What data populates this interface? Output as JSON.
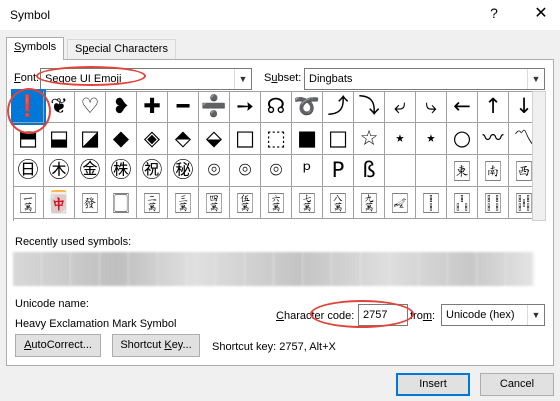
{
  "window": {
    "title": "Symbol",
    "help_glyph": "?",
    "close_glyph": "✕"
  },
  "tabs": [
    {
      "label": "Symbols",
      "active": true
    },
    {
      "label": "Special Characters",
      "active": false
    }
  ],
  "font": {
    "label": "Font:",
    "value": "Segoe UI Emoji"
  },
  "subset": {
    "label": "Subset:",
    "value": "Dingbats"
  },
  "grid": {
    "rows": [
      [
        "❗",
        "❦",
        "♡",
        "❥",
        "✚",
        "━",
        "➗",
        "➙",
        "☊",
        "➰",
        "⤴",
        "⤵",
        "⤶",
        "⤷",
        "←",
        "↑",
        "↓"
      ],
      [
        "⬒",
        "⬓",
        "◪",
        "◆",
        "◈",
        "⬘",
        "⬙",
        "□",
        "⬚",
        "■",
        "□",
        "☆",
        "⋆",
        "⋆",
        "○",
        "〰",
        "〽"
      ],
      [
        "㊐",
        "㊍",
        "㊎",
        "㊑",
        "㊗",
        "㊙",
        "⌾",
        "⌾",
        "⌾",
        "ᵖ",
        "P",
        "ß",
        " ",
        " ",
        "🀀",
        "🀁",
        "🀂",
        "🀃"
      ],
      [
        "🀇",
        "🀄",
        "🀅",
        "🀆",
        "🀈",
        "🀉",
        "🀊",
        "🀋",
        "🀌",
        "🀍",
        "🀎",
        "🀏",
        "🀐",
        "🀑",
        "🀒",
        "🀓",
        "🀔"
      ]
    ]
  },
  "recent": {
    "label": "Recently used symbols:"
  },
  "unicode": {
    "label": "Unicode name:",
    "value": "Heavy Exclamation Mark Symbol"
  },
  "charcode": {
    "label": "Character code:",
    "value": "2757",
    "from_label": "from:",
    "from_value": "Unicode (hex)"
  },
  "shortcut": {
    "autocorrect_label": "AutoCorrect...",
    "shortcutkey_label": "Shortcut Key...",
    "text": "Shortcut key: 2757, Alt+X"
  },
  "footer": {
    "insert_label": "Insert",
    "cancel_label": "Cancel"
  },
  "colors": {
    "selection": "#0078d7",
    "annotation": "#e0443a"
  }
}
